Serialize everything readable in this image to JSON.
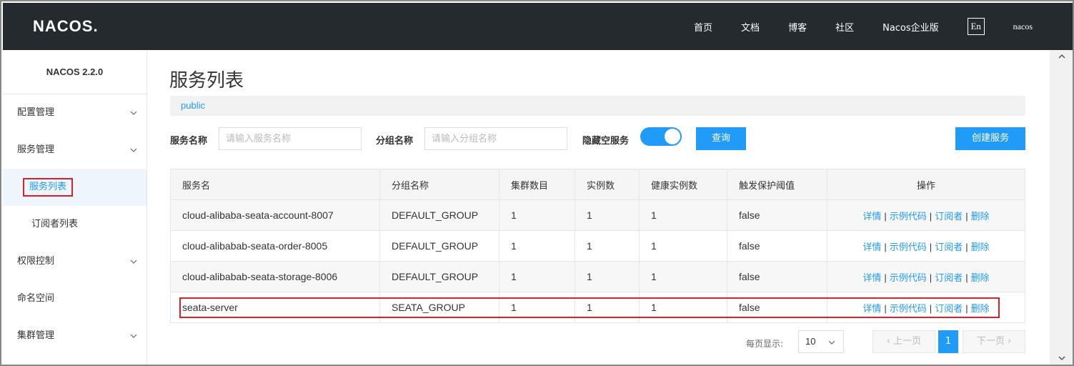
{
  "header": {
    "logo": "NACOS.",
    "nav": [
      "首页",
      "文档",
      "博客",
      "社区",
      "Nacos企业版"
    ],
    "lang": "En",
    "user": "nacos"
  },
  "sidebar": {
    "version": "NACOS 2.2.0",
    "items": [
      {
        "label": "配置管理"
      },
      {
        "label": "服务管理"
      },
      {
        "label": "服务列表"
      },
      {
        "label": "订阅者列表"
      },
      {
        "label": "权限控制"
      },
      {
        "label": "命名空间"
      },
      {
        "label": "集群管理"
      }
    ]
  },
  "main": {
    "title": "服务列表",
    "namespace": "public",
    "filters": {
      "service_label": "服务名称",
      "service_placeholder": "请输入服务名称",
      "group_label": "分组名称",
      "group_placeholder": "请输入分组名称",
      "hide_empty_label": "隐藏空服务",
      "hide_empty_on": true,
      "query_button": "查询",
      "create_button": "创建服务"
    },
    "table": {
      "headers": [
        "服务名",
        "分组名称",
        "集群数目",
        "实例数",
        "健康实例数",
        "触发保护阈值",
        "操作"
      ],
      "rows": [
        {
          "name": "cloud-alibaba-seata-account-8007",
          "group": "DEFAULT_GROUP",
          "clusters": "1",
          "instances": "1",
          "healthy": "1",
          "threshold": "false"
        },
        {
          "name": "cloud-alibabab-seata-order-8005",
          "group": "DEFAULT_GROUP",
          "clusters": "1",
          "instances": "1",
          "healthy": "1",
          "threshold": "false"
        },
        {
          "name": "cloud-alibabab-seata-storage-8006",
          "group": "DEFAULT_GROUP",
          "clusters": "1",
          "instances": "1",
          "healthy": "1",
          "threshold": "false"
        },
        {
          "name": "seata-server",
          "group": "SEATA_GROUP",
          "clusters": "1",
          "instances": "1",
          "healthy": "1",
          "threshold": "false"
        }
      ],
      "ops": [
        "详情",
        "示例代码",
        "订阅者",
        "删除"
      ]
    },
    "pagination": {
      "page_size_label": "每页显示:",
      "page_size": "10",
      "prev": "上一页",
      "current": "1",
      "next": "下一页"
    }
  },
  "colors": {
    "header_bg": "#252a2f",
    "accent": "#209bfa",
    "highlight": "#d9202c"
  }
}
